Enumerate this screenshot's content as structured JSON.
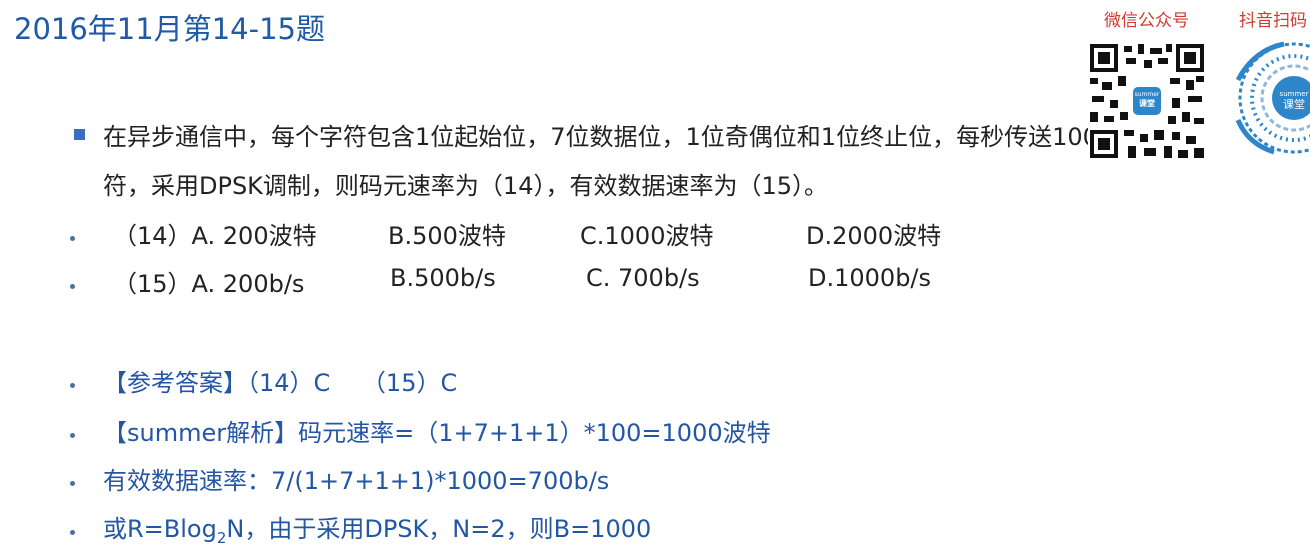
{
  "header": {
    "title": "2016年11月第14-15题"
  },
  "qr": {
    "wechat_label": "微信公众号",
    "douyin_label": "抖音扫码",
    "logo_small": "summer",
    "logo_big": "课堂"
  },
  "question": {
    "line1": "在异步通信中，每个字符包含1位起始位，7位数据位，1位奇偶位和1位终止位，每秒传送100个字",
    "line2": "符，采用DPSK调制，则码元速率为（14），有效数据速率为（15）。"
  },
  "options": [
    {
      "num": "（14）A. 200波特",
      "b": "B.500波特",
      "c": "C.1000波特",
      "d": "D.2000波特"
    },
    {
      "num": "（15）A. 200b/s",
      "b": "B.500b/s",
      "c": "C. 700b/s",
      "d": "D.1000b/s"
    }
  ],
  "answer": {
    "ref": "【参考答案】（14）C　 （15）C",
    "analysis": "【summer解析】码元速率=（1+7+1+1）*100=1000波特",
    "effective": "有效数据速率：7/(1+7+1+1)*1000=700b/s",
    "formula_pre": "或R=Blog",
    "formula_sub": "2",
    "formula_post": "N，由于采用DPSK，N=2，则B=1000"
  }
}
